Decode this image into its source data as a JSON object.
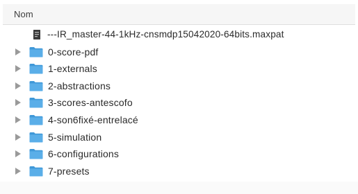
{
  "header": {
    "name_column": "Nom"
  },
  "file": {
    "name": "---IR_master-44-1kHz-cnsmdp15042020-64bits.maxpat"
  },
  "folders": [
    "0-score-pdf",
    "1-externals",
    "2-abstractions",
    "3-scores-antescofo",
    "4-son6fixé-entrelacé",
    "5-simulation",
    "6-configurations",
    "7-presets"
  ],
  "colors": {
    "folder_blue": "#5aaee8",
    "folder_tab": "#3f98d8",
    "disclosure": "#9a9a9a"
  }
}
